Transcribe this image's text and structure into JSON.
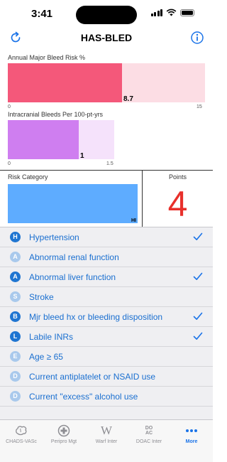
{
  "status": {
    "time": "3:41"
  },
  "nav": {
    "title": "HAS-BLED"
  },
  "gauges": {
    "annual": {
      "label": "Annual Major Bleed Risk %",
      "value": "8.7",
      "fraction": 0.58,
      "min": "0",
      "max": "15",
      "fill_color": "#f4587a",
      "bg_color": "#fcdde4"
    },
    "ich": {
      "label": "Intracranial Bleeds Per 100-pt-yrs",
      "value": "1",
      "fraction": 0.667,
      "min": "0",
      "max": "1.5",
      "fill_color": "#cf7ef0",
      "bg_color": "#f5e2fb"
    },
    "risk": {
      "label": "Risk Category",
      "value": "HI",
      "fill_color": "#5eacff"
    }
  },
  "points": {
    "label": "Points",
    "value": "4",
    "color": "#e8302b"
  },
  "items": [
    {
      "letter": "H",
      "label": "Hypertension",
      "checked": true
    },
    {
      "letter": "A",
      "label": "Abnormal renal function",
      "checked": false
    },
    {
      "letter": "A",
      "label": "Abnormal liver function",
      "checked": true
    },
    {
      "letter": "S",
      "label": "Stroke",
      "checked": false
    },
    {
      "letter": "B",
      "label": "Mjr bleed hx or bleeding disposition",
      "checked": true
    },
    {
      "letter": "L",
      "label": "Labile INRs",
      "checked": true
    },
    {
      "letter": "E",
      "label": "Age ≥ 65",
      "checked": false
    },
    {
      "letter": "D",
      "label": "Current antiplatelet or NSAID use",
      "checked": false
    },
    {
      "letter": "D",
      "label": "Current \"excess\" alcohol use",
      "checked": false
    }
  ],
  "tabs": [
    {
      "label": "CHADS-VASc",
      "icon": "brain-icon",
      "active": false
    },
    {
      "label": "Peripro Mgt",
      "icon": "plus-circle-icon",
      "active": false
    },
    {
      "label": "Warf Inter",
      "icon": "w-letter-icon",
      "active": false
    },
    {
      "label": "DOAC Inter",
      "icon": "doac-icon",
      "icon_text": "DO\nAC",
      "active": false
    },
    {
      "label": "More",
      "icon": "more-dots-icon",
      "active": true
    }
  ],
  "colors": {
    "accent": "#1a6fd0",
    "badge_on": "#1f75d1",
    "badge_off": "#a9c9ec"
  }
}
